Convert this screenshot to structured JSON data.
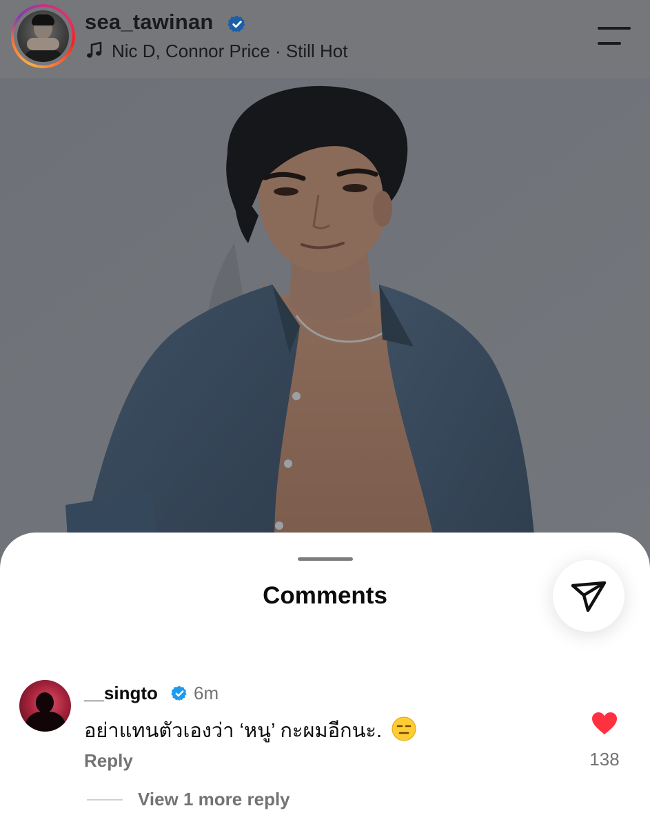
{
  "header": {
    "username": "sea_tawinan",
    "music": "Nic D, Connor Price · Still Hot"
  },
  "sheet": {
    "title": "Comments"
  },
  "comment": {
    "username": "__singto",
    "time": "6m",
    "text": "อย่าแทนตัวเองว่า ‘หนู’ กะผมอีกนะ.",
    "emoji": "expressionless-face-emoji",
    "reply_label": "Reply",
    "like_count": "138",
    "view_more_label": "View 1 more reply"
  },
  "colors": {
    "verified": "#1d9bf0",
    "heart": "#ff3040",
    "muted_text": "#737373",
    "overlay": "#76777b"
  },
  "icons": [
    "verified-badge-icon",
    "music-note-icon",
    "menu-icon",
    "share-icon",
    "heart-icon"
  ]
}
